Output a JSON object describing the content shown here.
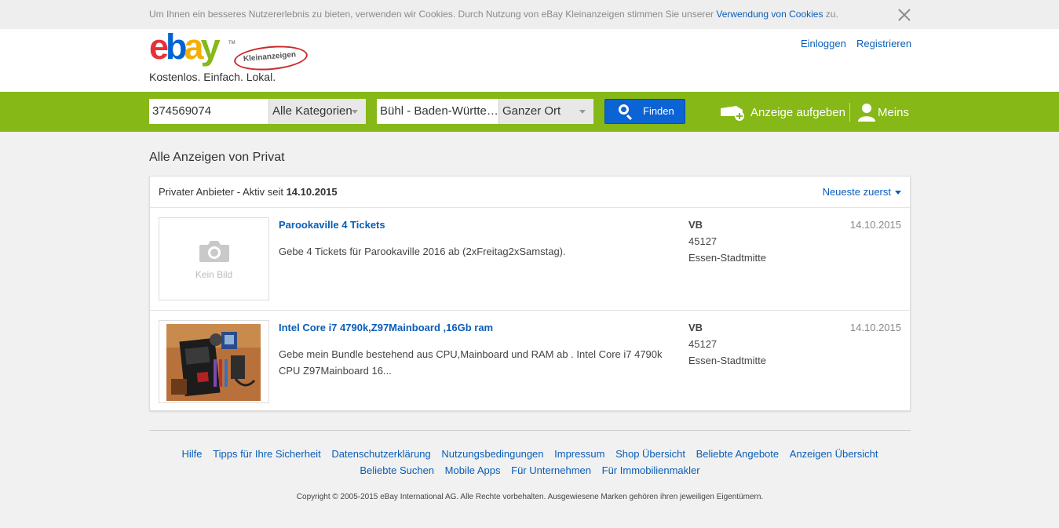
{
  "cookie_bar": {
    "text": "Um Ihnen ein besseres Nutzererlebnis zu bieten, verwenden wir Cookies. Durch Nutzung von eBay Kleinanzeigen stimmen Sie unserer ",
    "link": "Verwendung von Cookies",
    "suffix": " zu."
  },
  "header": {
    "logo_e": "e",
    "logo_b": "b",
    "logo_a": "a",
    "logo_y": "y",
    "logo_tm": "TM",
    "logo_badge": "Kleinanzeigen",
    "tagline": "Kostenlos. Einfach. Lokal.",
    "login": "Einloggen",
    "register": "Registrieren"
  },
  "search": {
    "query": "374569074",
    "category": "Alle Kategorien",
    "location": "Bühl - Baden-Württe…",
    "radius": "Ganzer Ort",
    "find_label": "Finden",
    "post_ad": "Anzeige aufgeben",
    "account": "Meins"
  },
  "page": {
    "title": "Alle Anzeigen von Privat",
    "seller_prefix": "Privater Anbieter - Aktiv seit ",
    "seller_since": "14.10.2015",
    "sort": "Neueste zuerst"
  },
  "listings": [
    {
      "title": "Parookaville 4 Tickets",
      "description": "Gebe 4 Tickets für Parookaville 2016 ab (2xFreitag2xSamstag).",
      "price": "VB",
      "zip": "45127",
      "city": "Essen-Stadtmitte",
      "date": "14.10.2015",
      "no_image_label": "Kein Bild"
    },
    {
      "title": "Intel Core i7 4790k,Z97Mainboard ,16Gb ram",
      "description": "Gebe mein Bundle bestehend aus CPU,Mainboard und RAM ab . Intel Core i7 4790k CPU Z97Mainboard 16...",
      "price": "VB",
      "zip": "45127",
      "city": "Essen-Stadtmitte",
      "date": "14.10.2015"
    }
  ],
  "footer": {
    "row1": [
      "Hilfe",
      "Tipps für Ihre Sicherheit",
      "Datenschutzerklärung",
      "Nutzungsbedingungen",
      "Impressum",
      "Shop Übersicht",
      "Beliebte Angebote",
      "Anzeigen Übersicht"
    ],
    "row2": [
      "Beliebte Suchen",
      "Mobile Apps",
      "Für Unternehmen",
      "Für Immobilienmakler"
    ],
    "copyright": "Copyright © 2005-2015 eBay International AG. Alle Rechte vorbehalten. Ausgewiesene Marken gehören ihren jeweiligen Eigentümern."
  },
  "colors": {
    "brand_green": "#86b817",
    "link_blue": "#0a5db8",
    "button_blue": "#0c63d4"
  },
  "icons": {
    "close": "close-icon",
    "search": "search-icon",
    "post_ad": "car-plus-icon",
    "account": "user-icon",
    "no_image": "camera-icon"
  }
}
